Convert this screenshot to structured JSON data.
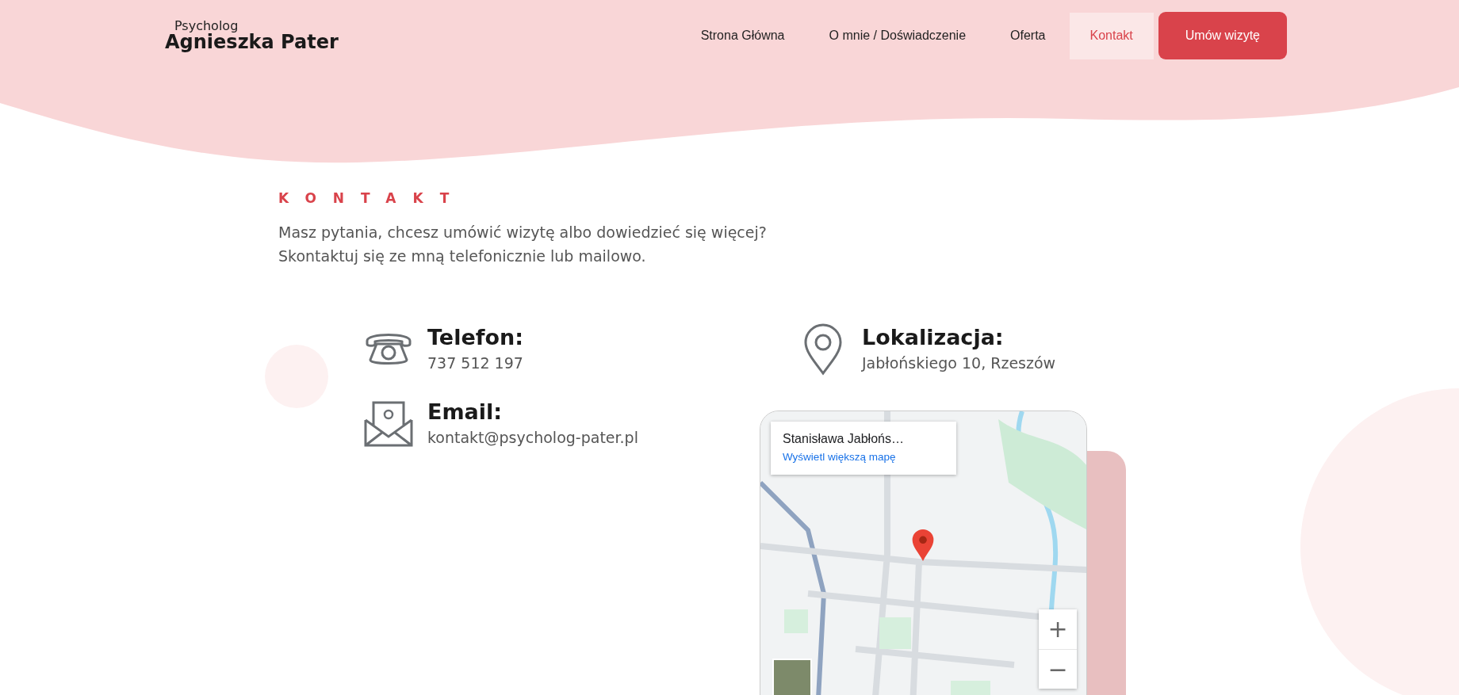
{
  "header": {
    "logo": {
      "subtitle": "Psycholog",
      "name": "Agnieszka Pater"
    },
    "nav": [
      {
        "label": "Strona Główna",
        "selected": false
      },
      {
        "label": "O mnie / Doświadczenie",
        "selected": false
      },
      {
        "label": "Oferta",
        "selected": false
      },
      {
        "label": "Kontakt",
        "selected": true
      }
    ],
    "cta": "Umów wizytę"
  },
  "section": {
    "eyebrow": "KONTAKT",
    "lines": [
      "Masz pytania, chcesz umówić wizytę albo dowiedzieć się więcej?",
      "Skontaktuj się ze mną telefonicznie lub mailowo."
    ]
  },
  "contacts": [
    {
      "kind": "phone",
      "title": "Telefon:",
      "value": "737 512 197"
    },
    {
      "kind": "email",
      "title": "Email:",
      "value": "kontakt@psycholog-pater.pl"
    },
    {
      "kind": "location",
      "title": "Lokalizacja:",
      "value": "Jabłońskiego 10, Rzeszów"
    }
  ],
  "map": {
    "place": "Stanisława Jabłońs…",
    "link": "Wyświetl większą mapę",
    "zoom_in": "+",
    "zoom_out": "−"
  }
}
